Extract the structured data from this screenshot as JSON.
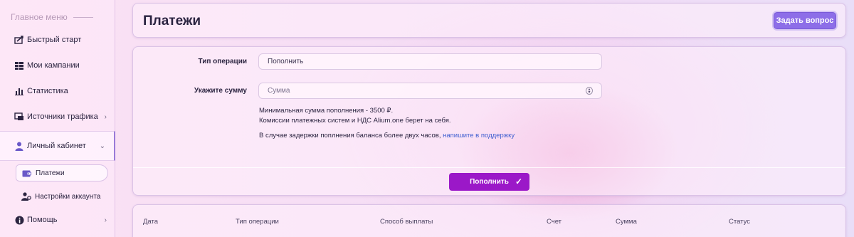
{
  "sidebar": {
    "menu_title": "Главное меню",
    "items": [
      {
        "label": "Быстрый старт",
        "icon": "rocket-icon"
      },
      {
        "label": "Мои кампании",
        "icon": "campaigns-icon"
      },
      {
        "label": "Статистика",
        "icon": "bar-chart-icon"
      },
      {
        "label": "Источники трафика",
        "icon": "traffic-icon"
      },
      {
        "label": "Личный кабинет",
        "icon": "user-icon"
      },
      {
        "label": "Помощь",
        "icon": "info-icon"
      }
    ],
    "sub_items": [
      {
        "label": "Платежи",
        "icon": "wallet-icon"
      },
      {
        "label": "Настройки аккаунта",
        "icon": "user-settings-icon"
      }
    ],
    "accent": "#9a7ad8"
  },
  "header": {
    "title": "Платежи",
    "ask_button": "Задать вопрос",
    "ask_color": "#8d6ee8"
  },
  "form": {
    "operation_label": "Тип операции",
    "operation_value": "Пополнить",
    "amount_label": "Укажите сумму",
    "amount_placeholder": "Сумма",
    "info_min": "Минимальная сумма пополнения - 3500 ₽.",
    "info_fees": "Комиссии платежных систем и НДС Alium.one берет на себя.",
    "info_delay": "В случае задержки поплнения баланса более двух часов,",
    "info_link": "напишите в поддержку",
    "submit_label": "Пополнить",
    "submit_color": "#9b18c8",
    "link_color": "#3f5fd0"
  },
  "table": {
    "headers": [
      "Дата",
      "Тип операции",
      "Способ выплаты",
      "Счет",
      "Сумма",
      "Статус"
    ]
  }
}
